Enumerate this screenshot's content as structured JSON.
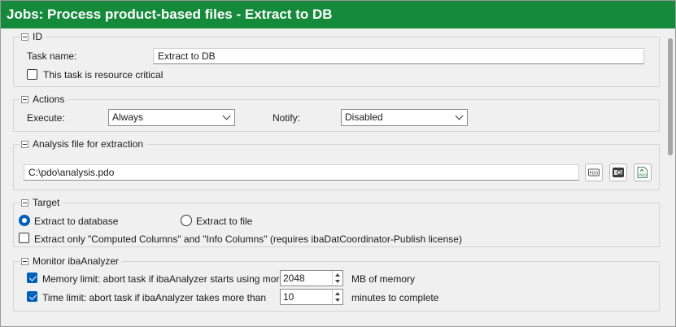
{
  "window": {
    "title": "Jobs: Process product-based files - Extract to DB"
  },
  "id_group": {
    "title": "ID",
    "task_name_label": "Task name:",
    "task_name_value": "Extract to DB",
    "resource_critical_label": "This task is resource critical",
    "resource_critical_checked": false
  },
  "actions_group": {
    "title": "Actions",
    "execute_label": "Execute:",
    "execute_value": "Always",
    "notify_label": "Notify:",
    "notify_value": "Disabled"
  },
  "analysis_group": {
    "title": "Analysis file for extraction",
    "path_value": "C:\\pdo\\analysis.pdo",
    "icons": [
      "pdo-file-icon",
      "analyzer-preview-icon",
      "new-pdo-icon"
    ]
  },
  "target_group": {
    "title": "Target",
    "option_database": "Extract to database",
    "option_file": "Extract to file",
    "selected": "Extract to database",
    "computed_only_label": "Extract only \"Computed Columns\" and \"Info Columns\" (requires ibaDatCoordinator-Publish license)",
    "computed_only_checked": false
  },
  "monitor_group": {
    "title": "Monitor ibaAnalyzer",
    "memory_limit_label": "Memory limit: abort task if ibaAnalyzer starts using more than",
    "memory_limit_value": "2048",
    "memory_limit_unit": "MB of memory",
    "memory_limit_checked": true,
    "time_limit_label": "Time limit: abort task if ibaAnalyzer takes more than",
    "time_limit_value": "10",
    "time_limit_unit": "minutes to complete",
    "time_limit_checked": true
  },
  "colors": {
    "titlebar": "#168a3b",
    "accent": "#005fb8"
  }
}
